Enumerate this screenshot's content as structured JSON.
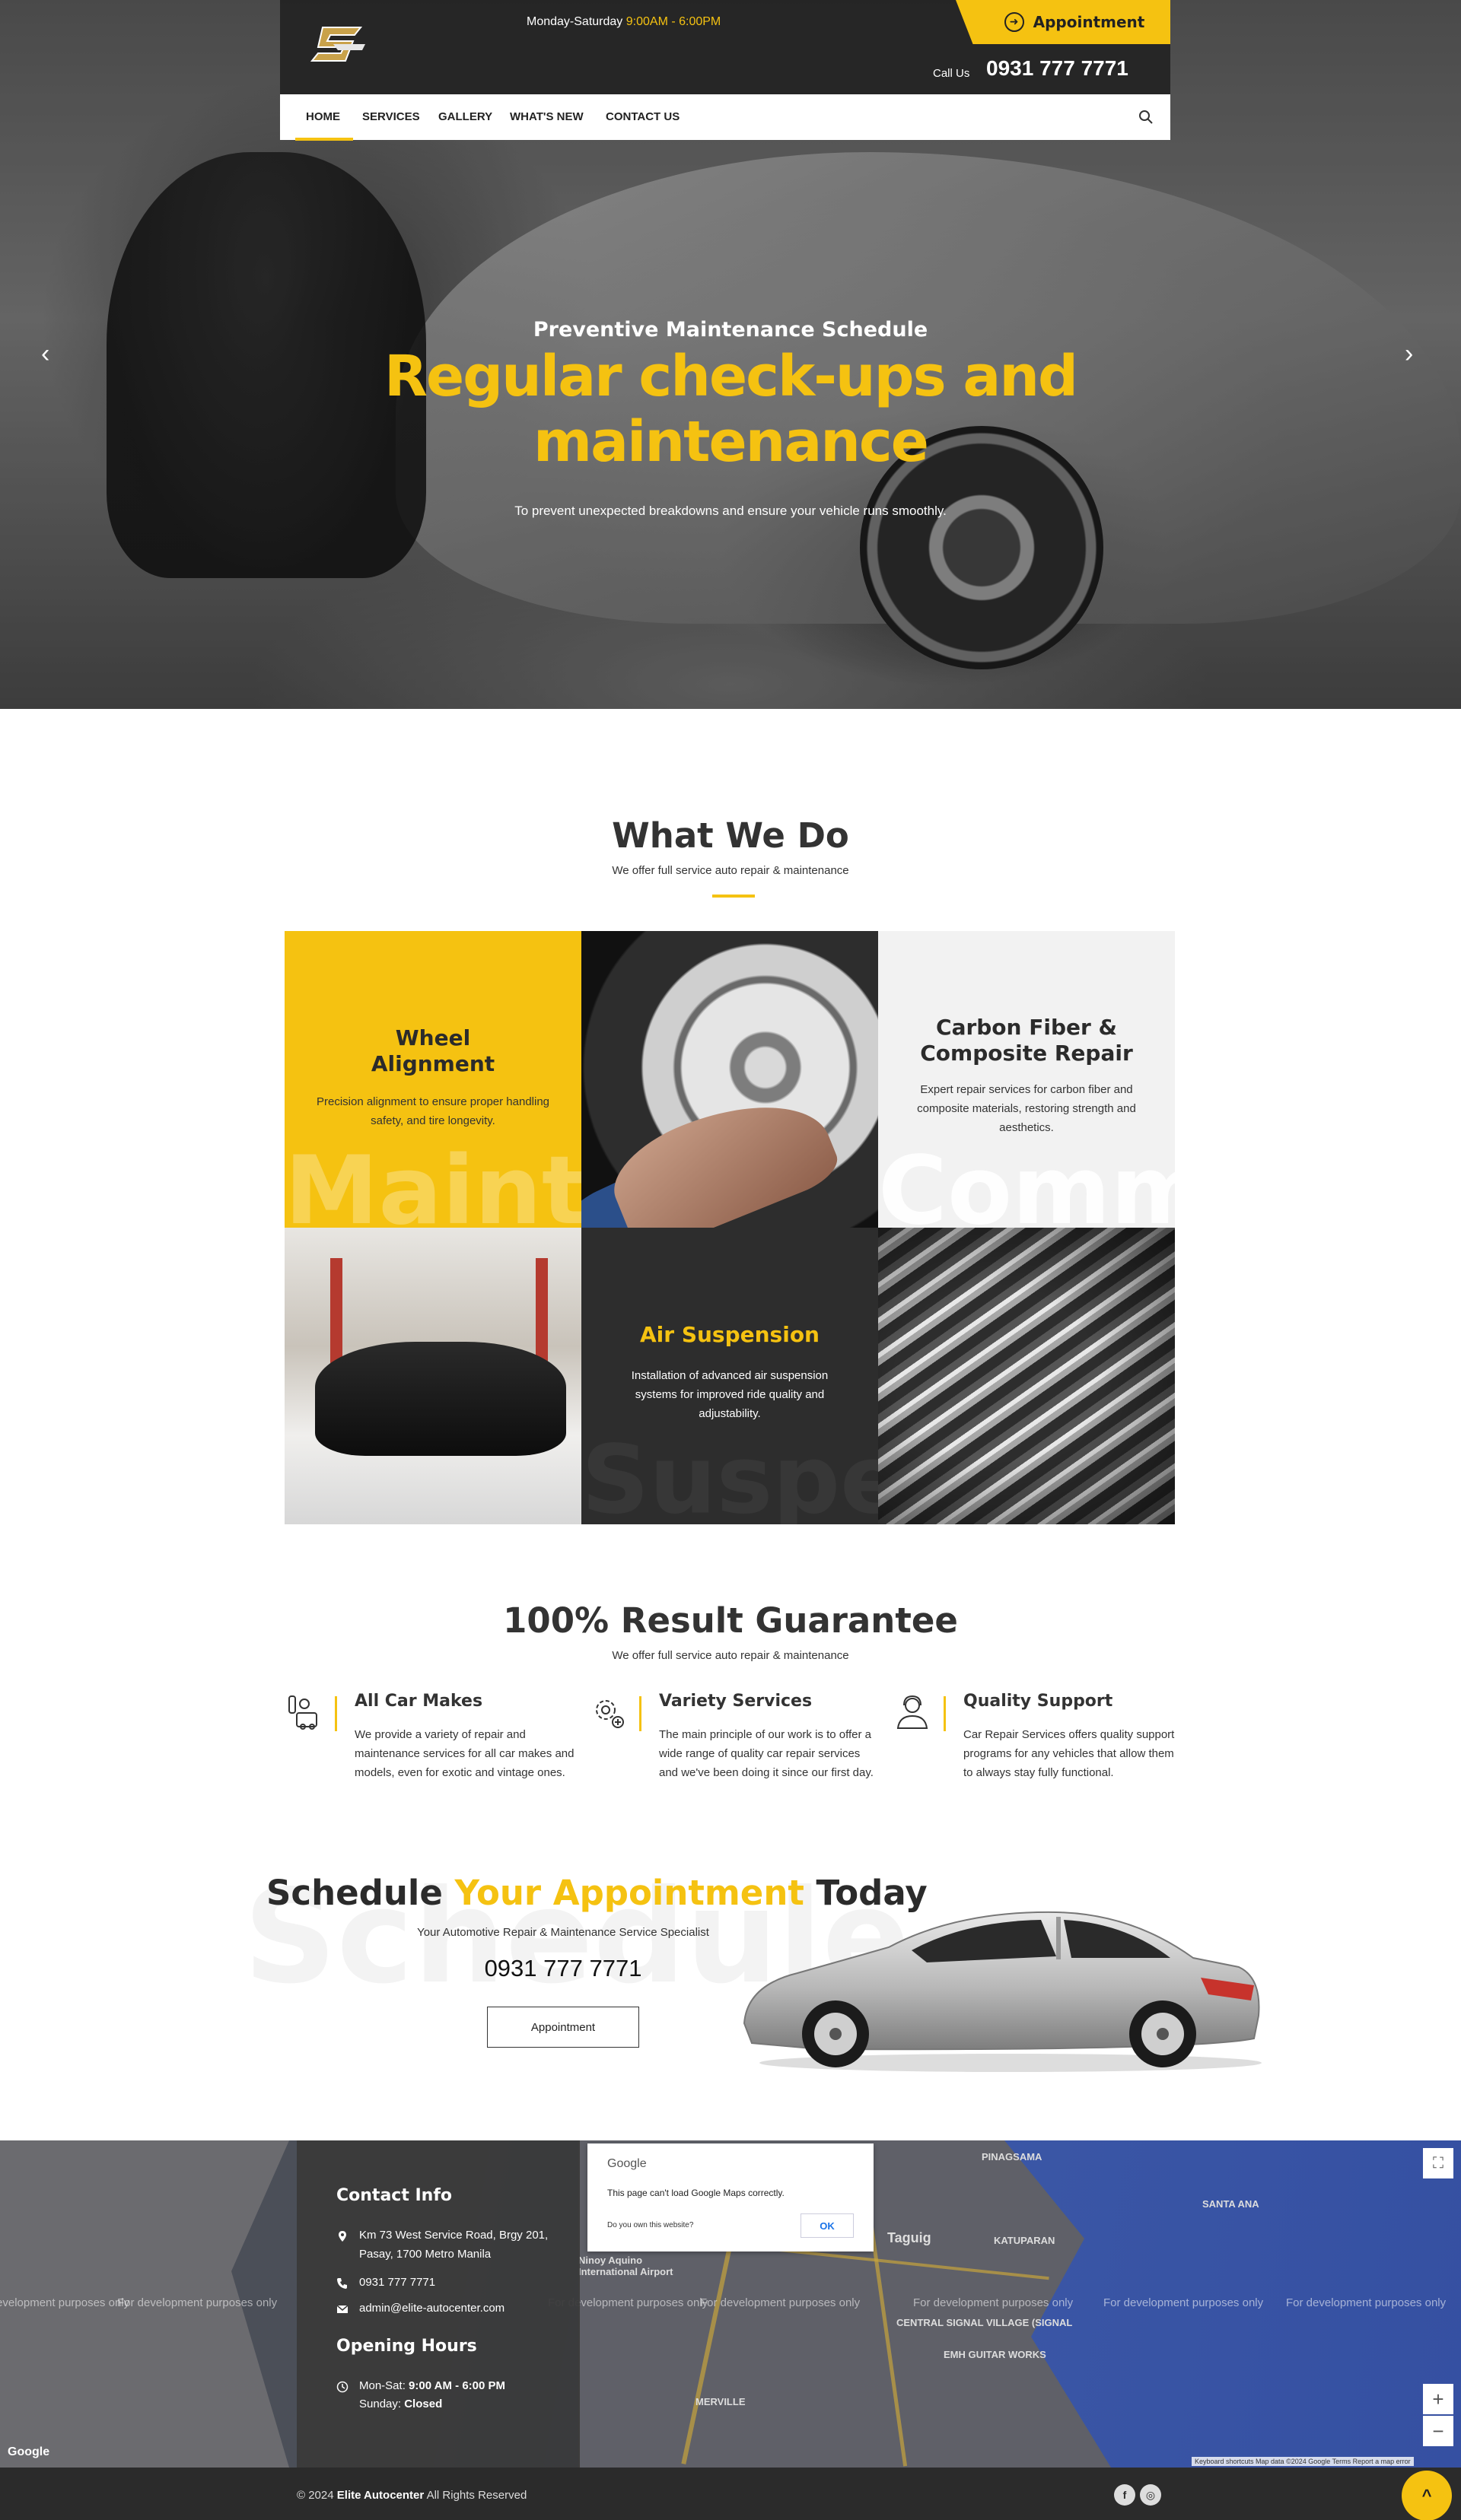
{
  "colors": {
    "accent": "#f5c211",
    "dark": "#2b2b2b",
    "light_tile": "#f2f2f2"
  },
  "header": {
    "hours_label": "Monday-Saturday",
    "hours_time": "9:00AM - 6:00PM",
    "appointment_label": "Appointment",
    "call_label": "Call Us",
    "phone": "0931 777 7771",
    "logo_icon": "brand-logo"
  },
  "nav": {
    "items": [
      "HOME",
      "SERVICES",
      "GALLERY",
      "WHAT'S NEW",
      "CONTACT US"
    ],
    "active": "HOME",
    "search_icon": "search-icon"
  },
  "hero": {
    "subtitle": "Preventive Maintenance Schedule",
    "title": "Regular check-ups and maintenance",
    "description": "To prevent unexpected breakdowns and ensure your vehicle runs smoothly.",
    "prev": "‹",
    "next": "›"
  },
  "what_we_do": {
    "title": "What We Do",
    "subtitle": "We offer full service auto repair & maintenance",
    "tiles": [
      {
        "title": "Wheel Alignment",
        "text": "Precision alignment to ensure proper handling safety, and tire longevity.",
        "ghost": "Maintenance"
      },
      {
        "title": "Carbon Fiber & Composite Repair",
        "text": "Expert repair services for carbon fiber and composite materials, restoring strength and aesthetics.",
        "ghost": "Commercial"
      },
      {
        "title": "Air Suspension",
        "text": "Installation of advanced air suspension systems for improved ride quality and adjustability.",
        "ghost": "Suspension"
      }
    ]
  },
  "guarantee": {
    "title": "100% Result Guarantee",
    "subtitle": "We offer full service auto repair & maintenance",
    "features": [
      {
        "icon": "mechanic-tools-icon",
        "title": "All Car Makes",
        "text": "We provide a variety of repair and maintenance services for all car makes and models, even for exotic and vintage ones."
      },
      {
        "icon": "gear-plus-icon",
        "title": "Variety Services",
        "text": "The main principle of our work is to offer a wide range of quality car repair services and we've been doing it since our first day."
      },
      {
        "icon": "support-agent-icon",
        "title": "Quality Support",
        "text": "Car Repair Services offers quality support programs for any vehicles that allow them to always stay fully functional."
      }
    ]
  },
  "appointment": {
    "ghost": "Schedule",
    "title_a": "Schedule ",
    "title_b": "Your Appointment",
    "title_c": " Today",
    "subtitle": "Your Automotive Repair & Maintenance Service Specialist",
    "phone": "0931 777 7771",
    "button": "Appointment"
  },
  "contact": {
    "title": "Contact Info",
    "address": "Km 73 West Service Road, Brgy 201, Pasay, 1700 Metro Manila",
    "phone": "0931 777 7771",
    "email": "admin@elite-autocenter.com",
    "hours_title": "Opening Hours",
    "hours_days": "Mon-Sat:",
    "hours_time": "9:00 AM - 6:00 PM",
    "sunday_label": "Sunday:",
    "sunday_value": "Closed"
  },
  "map": {
    "dialog_brand": "Google",
    "dialog_msg": "This page can't load Google Maps correctly.",
    "dialog_own": "Do you own this website?",
    "dialog_ok": "OK",
    "dev_text": "For development purposes only",
    "google_mark": "Google",
    "attribution": "Keyboard shortcuts   Map data ©2024 Google   Terms   Report a map error",
    "labels": [
      "PINAGSAMA",
      "SANTA ANA",
      "Taguig",
      "KATUPARAN",
      "CENTRAL SIGNAL VILLAGE (SIGNAL",
      "EMH GUITAR WORKS",
      "MERVILLE",
      "Ninoy Aquino International Airport"
    ],
    "zoom_in": "+",
    "zoom_out": "−",
    "fullscreen": "⛶"
  },
  "footer": {
    "copy_a": "© 2024 ",
    "copy_brand": "Elite Autocenter",
    "copy_b": " All Rights Reserved",
    "social": [
      "f",
      "◎"
    ],
    "to_top": "^"
  }
}
